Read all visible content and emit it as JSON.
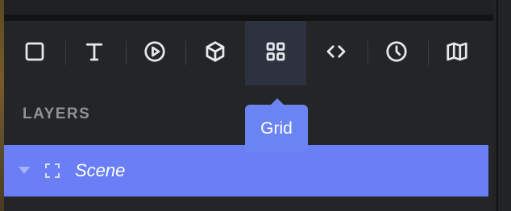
{
  "toolbar": {
    "tools": [
      {
        "name": "rectangle",
        "icon": "square-icon",
        "active": false
      },
      {
        "name": "text",
        "icon": "text-icon",
        "active": false
      },
      {
        "name": "play",
        "icon": "play-circle-icon",
        "active": false
      },
      {
        "name": "3d-box",
        "icon": "cube-icon",
        "active": false
      },
      {
        "name": "grid",
        "icon": "grid-icon",
        "active": true
      },
      {
        "name": "code",
        "icon": "code-icon",
        "active": false
      },
      {
        "name": "clock",
        "icon": "clock-icon",
        "active": false
      },
      {
        "name": "map",
        "icon": "map-icon",
        "active": false
      }
    ]
  },
  "layers": {
    "title": "LAYERS",
    "items": [
      {
        "label": "Scene",
        "icon": "frame-icon",
        "expanded": true,
        "selected": true
      }
    ]
  },
  "tooltip": {
    "text": "Grid"
  },
  "colors": {
    "background": "#242526",
    "selection": "#6a7ff5",
    "tooltip": "#6a84f3",
    "active_tool": "#2e3240",
    "section_title": "#8f9296"
  }
}
